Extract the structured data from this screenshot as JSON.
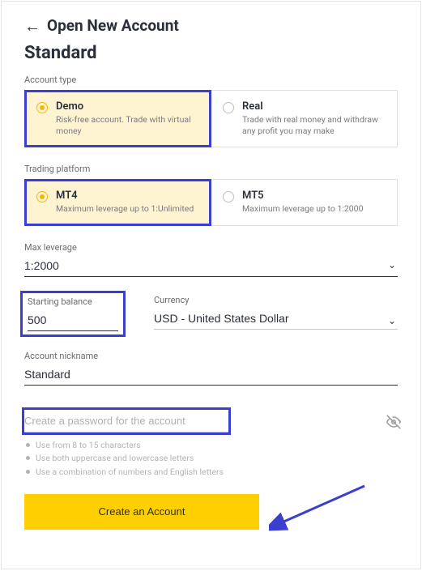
{
  "header": {
    "back_icon": "←",
    "title": "Open New Account",
    "subtitle": "Standard"
  },
  "accountType": {
    "label": "Account type",
    "options": [
      {
        "title": "Demo",
        "desc": "Risk-free account. Trade with virtual money",
        "selected": true
      },
      {
        "title": "Real",
        "desc": "Trade with real money and withdraw any profit you may make",
        "selected": false
      }
    ]
  },
  "platform": {
    "label": "Trading platform",
    "options": [
      {
        "title": "MT4",
        "desc": "Maximum leverage up to 1:Unlimited",
        "selected": true
      },
      {
        "title": "MT5",
        "desc": "Maximum leverage up to 1:2000",
        "selected": false
      }
    ]
  },
  "leverage": {
    "label": "Max leverage",
    "value": "1:2000"
  },
  "balance": {
    "label": "Starting balance",
    "value": "500"
  },
  "currency": {
    "label": "Currency",
    "value": "USD - United States Dollar"
  },
  "nickname": {
    "label": "Account nickname",
    "value": "Standard"
  },
  "password": {
    "placeholder": "Create a password for the account",
    "hints": [
      "Use from 8 to 15 characters",
      "Use both uppercase and lowercase letters",
      "Use a combination of numbers and English letters"
    ]
  },
  "cta": {
    "label": "Create an Account"
  }
}
